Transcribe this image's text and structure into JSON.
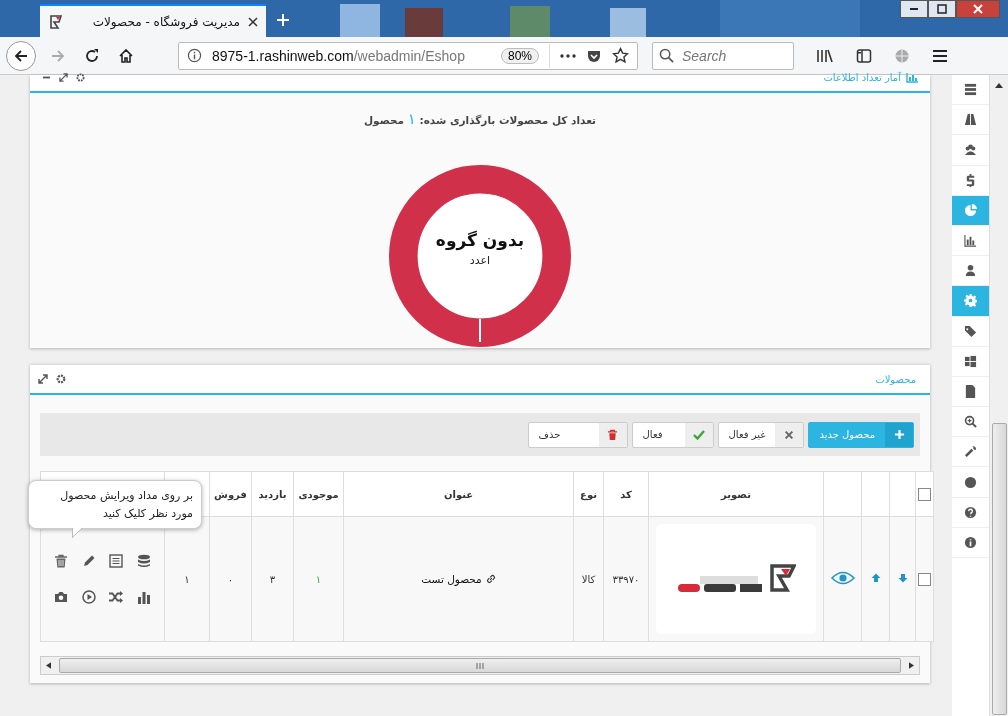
{
  "browser": {
    "tab_title": "مدیریت فروشگاه - محصولات",
    "url_host": "8975-1.rashinweb.com",
    "url_path": "/webadmin/Eshop",
    "zoom": "80%",
    "search_placeholder": "Search"
  },
  "stats_panel": {
    "title": "آمار تعداد اطلاعات",
    "total_label": "تعداد کل محصولات بارگذاری شده:",
    "total_count": "۱",
    "total_unit": "محصول",
    "center_title": "بدون گروه",
    "center_sub": "اعدد"
  },
  "products_panel": {
    "title": "محصولات",
    "toolbar": [
      {
        "label": "محصول جدید",
        "kind": "new"
      },
      {
        "label": "غیر فعال",
        "kind": "deactivate"
      },
      {
        "label": "فعال",
        "kind": "activate"
      },
      {
        "label": "حذف",
        "kind": "delete"
      }
    ],
    "header_checked": false,
    "columns": [
      "تصویر",
      "کد",
      "نوع",
      "عنوان",
      "موجودی",
      "بازدید",
      "فروش"
    ],
    "rows": [
      {
        "checked": false,
        "code": "۳۳۹۷۰",
        "type": "کالا",
        "title": "محصول تست",
        "stock": "۱",
        "visits": "۳",
        "sales": "۰",
        "column_12": "۱"
      }
    ],
    "tooltip": "بر روی مداد ویرایش محصول مورد نظر کلیک کنید"
  },
  "sidebar": {
    "items": [
      {
        "kind": "list",
        "selected": false
      },
      {
        "kind": "road",
        "selected": false
      },
      {
        "kind": "users",
        "selected": false
      },
      {
        "kind": "dollar",
        "selected": false
      },
      {
        "kind": "pie",
        "selected": true
      },
      {
        "kind": "bars",
        "selected": false
      },
      {
        "kind": "user",
        "selected": false
      },
      {
        "kind": "gear",
        "selected": true
      },
      {
        "kind": "tags",
        "selected": false
      },
      {
        "kind": "windows",
        "selected": false
      },
      {
        "kind": "file",
        "selected": false
      },
      {
        "kind": "zoom",
        "selected": false
      },
      {
        "kind": "wrench",
        "selected": false
      },
      {
        "kind": "globe",
        "selected": false
      },
      {
        "kind": "help",
        "selected": false
      },
      {
        "kind": "info",
        "selected": false
      }
    ]
  }
}
